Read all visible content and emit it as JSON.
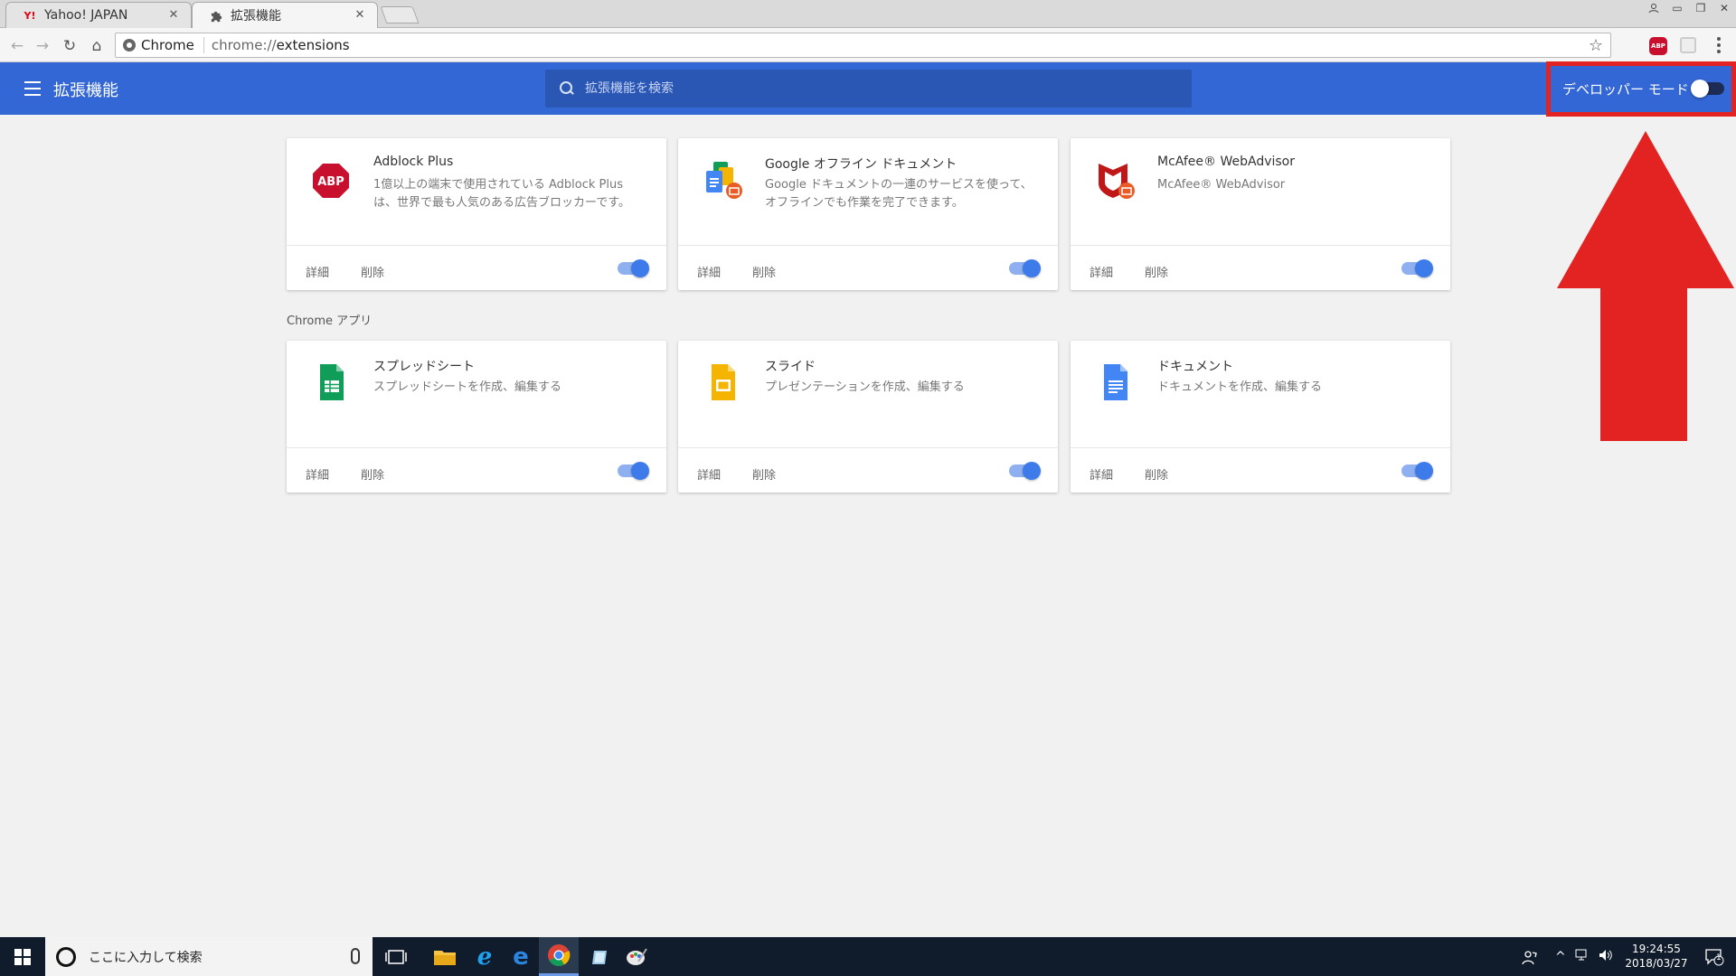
{
  "browser": {
    "tabs": [
      {
        "title": "Yahoo! JAPAN",
        "icon": "yahoo-icon"
      },
      {
        "title": "拡張機能",
        "icon": "puzzle-icon"
      }
    ],
    "omnibox": {
      "scheme_label": "Chrome",
      "url_prefix": "chrome://",
      "url_path": "extensions"
    },
    "ext_abp_label": "ABP"
  },
  "header": {
    "title": "拡張機能",
    "search_placeholder": "拡張機能を検索",
    "dev_mode_label": "デベロッパー モード",
    "dev_mode_on": false,
    "accent": "#3367d6"
  },
  "extensions": [
    {
      "name": "Adblock Plus",
      "desc": "1億以上の端末で使用されている Adblock Plus は、世界で最も人気のある広告ブロッカーです。",
      "detail": "詳細",
      "remove": "削除",
      "enabled": true
    },
    {
      "name": "Google オフライン ドキュメント",
      "desc": "Google ドキュメントの一連のサービスを使って、オフラインでも作業を完了できます。",
      "detail": "詳細",
      "remove": "削除",
      "enabled": true
    },
    {
      "name": "McAfee® WebAdvisor",
      "desc": "McAfee® WebAdvisor",
      "detail": "詳細",
      "remove": "削除",
      "enabled": true
    }
  ],
  "apps_section_label": "Chrome アプリ",
  "apps": [
    {
      "name": "スプレッドシート",
      "desc": "スプレッドシートを作成、編集する",
      "detail": "詳細",
      "remove": "削除",
      "enabled": true
    },
    {
      "name": "スライド",
      "desc": "プレゼンテーションを作成、編集する",
      "detail": "詳細",
      "remove": "削除",
      "enabled": true
    },
    {
      "name": "ドキュメント",
      "desc": "ドキュメントを作成、編集する",
      "detail": "詳細",
      "remove": "削除",
      "enabled": true
    }
  ],
  "annotation": {
    "color": "#e32322"
  },
  "taskbar": {
    "search_text": "ここに入力して検索",
    "time": "19:24:55",
    "date": "2018/03/27",
    "notification_count": "1"
  }
}
